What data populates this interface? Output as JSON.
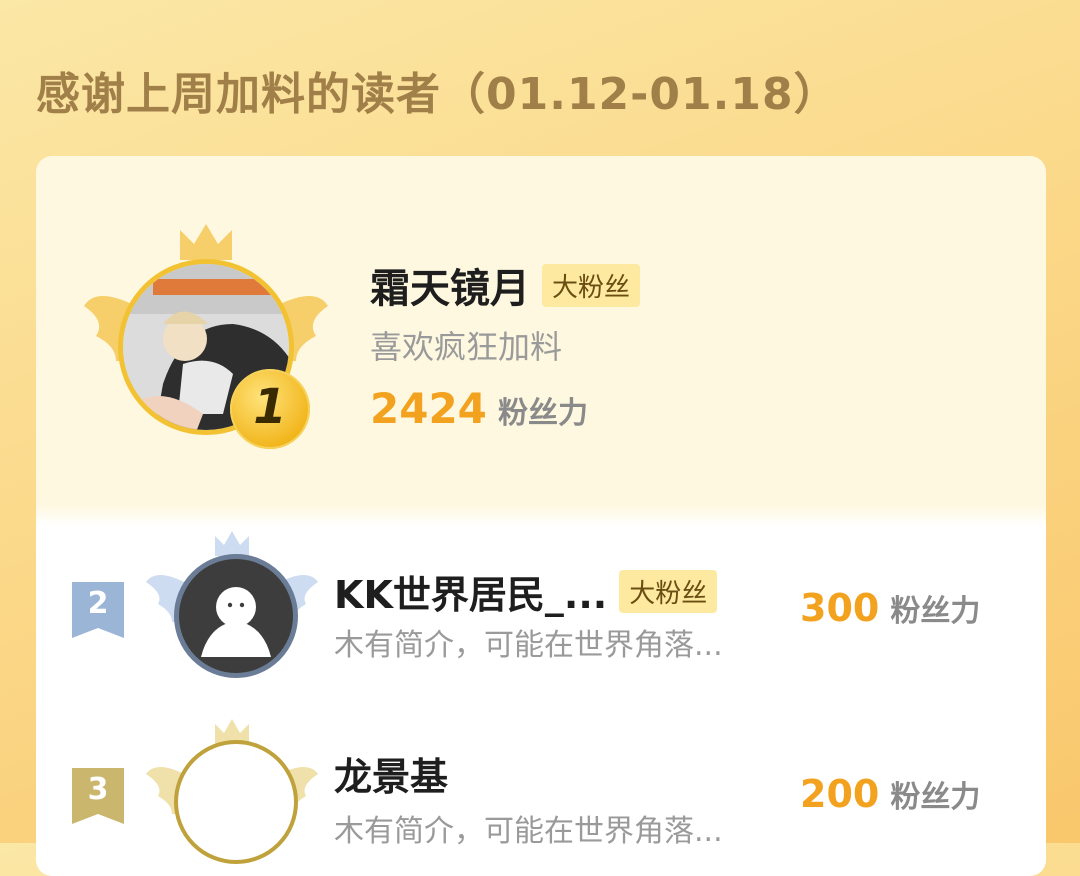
{
  "header": {
    "title": "感谢上周加料的读者（01.12-01.18）"
  },
  "leaderboard": [
    {
      "rank": "1",
      "name": "霜天镜月",
      "badge": "大粉丝",
      "bio": "喜欢疯狂加料",
      "points": "2424",
      "points_unit": "粉丝力"
    },
    {
      "rank": "2",
      "name": "KK世界居民_...",
      "badge": "大粉丝",
      "bio": "木有简介，可能在世界角落...",
      "points": "300",
      "points_unit": "粉丝力"
    },
    {
      "rank": "3",
      "name": "龙景基",
      "badge": "",
      "bio": "木有简介，可能在世界角落...",
      "points": "200",
      "points_unit": "粉丝力"
    }
  ],
  "colors": {
    "accent": "#f2a21e",
    "gold": "#e8b838",
    "silver": "#9ab5d6",
    "bronze": "#cbb66e"
  },
  "icons": [
    "crown-icon",
    "wings-icon",
    "rank-medal-icon",
    "default-avatar-icon"
  ]
}
